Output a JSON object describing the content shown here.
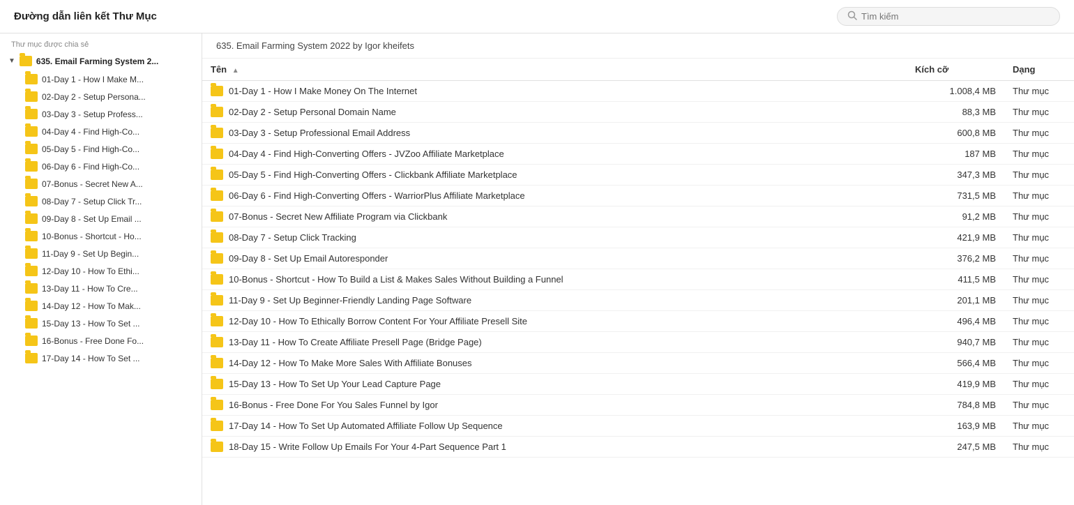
{
  "header": {
    "title": "Đường dẫn liên kết Thư Mục",
    "search_placeholder": "Tìm kiếm"
  },
  "sidebar": {
    "shared_label": "Thư mục được chia sẻ",
    "root_folder": "635. Email Farming System 2...",
    "items": [
      {
        "label": "01-Day 1 - How I Make M..."
      },
      {
        "label": "02-Day 2 - Setup Persona..."
      },
      {
        "label": "03-Day 3 - Setup Profess..."
      },
      {
        "label": "04-Day 4 - Find High-Co..."
      },
      {
        "label": "05-Day 5 - Find High-Co..."
      },
      {
        "label": "06-Day 6 - Find High-Co..."
      },
      {
        "label": "07-Bonus - Secret New A..."
      },
      {
        "label": "08-Day 7 - Setup Click Tr..."
      },
      {
        "label": "09-Day 8 - Set Up Email ..."
      },
      {
        "label": "10-Bonus - Shortcut - Ho..."
      },
      {
        "label": "11-Day 9 - Set Up Begin..."
      },
      {
        "label": "12-Day 10 - How To Ethi..."
      },
      {
        "label": "13-Day 11 - How To Cre..."
      },
      {
        "label": "14-Day 12 - How To Mak..."
      },
      {
        "label": "15-Day 13 - How To Set ..."
      },
      {
        "label": "16-Bonus - Free Done Fo..."
      },
      {
        "label": "17-Day 14 - How To Set ..."
      }
    ]
  },
  "breadcrumb": "635. Email Farming System 2022 by Igor kheifets",
  "table": {
    "col_name": "Tên",
    "col_size": "Kích cỡ",
    "col_type": "Dạng",
    "rows": [
      {
        "name": "01-Day 1 - How I Make Money On The Internet",
        "size": "1.008,4 MB",
        "type": "Thư mục"
      },
      {
        "name": "02-Day 2 - Setup Personal Domain Name",
        "size": "88,3 MB",
        "type": "Thư mục"
      },
      {
        "name": "03-Day 3 - Setup Professional Email Address",
        "size": "600,8 MB",
        "type": "Thư mục"
      },
      {
        "name": "04-Day 4 - Find High-Converting Offers - JVZoo Affiliate Marketplace",
        "size": "187 MB",
        "type": "Thư mục"
      },
      {
        "name": "05-Day 5 - Find High-Converting Offers - Clickbank Affiliate Marketplace",
        "size": "347,3 MB",
        "type": "Thư mục"
      },
      {
        "name": "06-Day 6 - Find High-Converting Offers - WarriorPlus Affiliate Marketplace",
        "size": "731,5 MB",
        "type": "Thư mục"
      },
      {
        "name": "07-Bonus - Secret New Affiliate Program via Clickbank",
        "size": "91,2 MB",
        "type": "Thư mục"
      },
      {
        "name": "08-Day 7 - Setup Click Tracking",
        "size": "421,9 MB",
        "type": "Thư mục"
      },
      {
        "name": "09-Day 8 - Set Up Email Autoresponder",
        "size": "376,2 MB",
        "type": "Thư mục"
      },
      {
        "name": "10-Bonus - Shortcut - How To Build a List & Makes Sales Without Building a Funnel",
        "size": "411,5 MB",
        "type": "Thư mục"
      },
      {
        "name": "11-Day 9 - Set Up Beginner-Friendly Landing Page Software",
        "size": "201,1 MB",
        "type": "Thư mục"
      },
      {
        "name": "12-Day 10 - How To Ethically Borrow Content For Your Affiliate Presell Site",
        "size": "496,4 MB",
        "type": "Thư mục"
      },
      {
        "name": "13-Day 11 - How To Create Affiliate Presell Page (Bridge Page)",
        "size": "940,7 MB",
        "type": "Thư mục"
      },
      {
        "name": "14-Day 12 - How To Make More Sales With Affiliate Bonuses",
        "size": "566,4 MB",
        "type": "Thư mục"
      },
      {
        "name": "15-Day 13 - How To Set Up Your Lead Capture Page",
        "size": "419,9 MB",
        "type": "Thư mục"
      },
      {
        "name": "16-Bonus - Free Done For You Sales Funnel by Igor",
        "size": "784,8 MB",
        "type": "Thư mục"
      },
      {
        "name": "17-Day 14 - How To Set Up Automated Affiliate Follow Up Sequence",
        "size": "163,9 MB",
        "type": "Thư mục"
      },
      {
        "name": "18-Day 15 - Write Follow Up Emails For Your 4-Part Sequence Part 1",
        "size": "247,5 MB",
        "type": "Thư mục"
      }
    ]
  }
}
